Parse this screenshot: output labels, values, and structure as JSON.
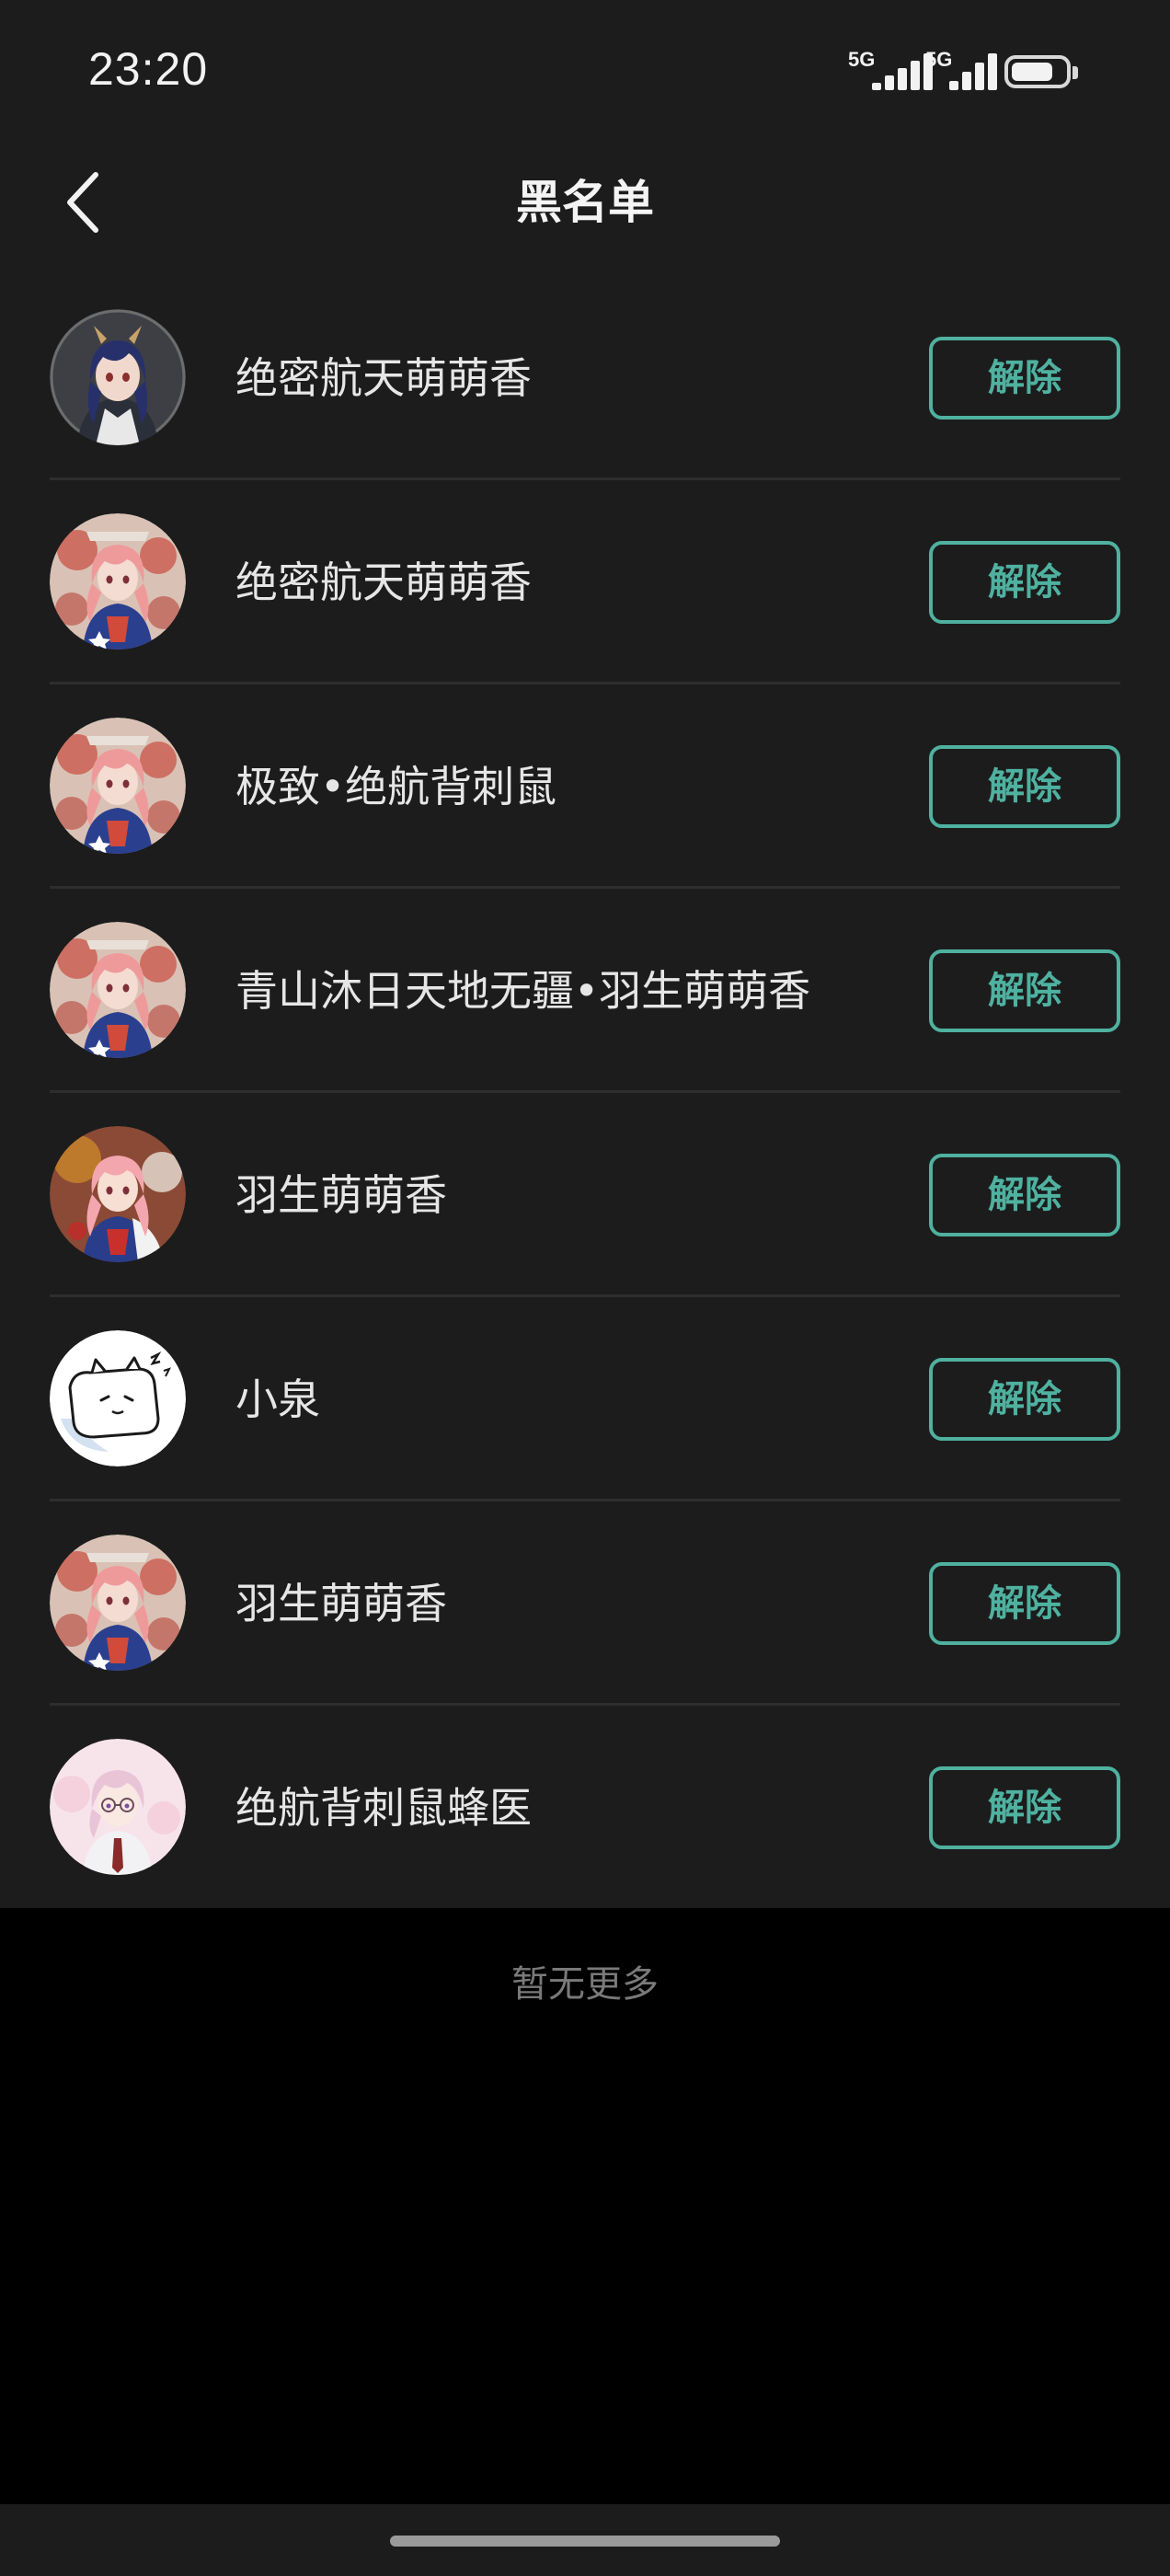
{
  "status_bar": {
    "time": "23:20",
    "network_1": "5G",
    "network_2": "5G"
  },
  "header": {
    "back_icon": "chevron-left-icon",
    "title": "黑名单"
  },
  "blocked_users": [
    {
      "name": "绝密航天萌萌香",
      "action": "解除",
      "avatar": "anime-girl-dark-hair"
    },
    {
      "name": "绝密航天萌萌香",
      "action": "解除",
      "avatar": "anime-girl-pink-hair"
    },
    {
      "name": "极致•绝航背刺鼠",
      "action": "解除",
      "avatar": "anime-girl-pink-hair"
    },
    {
      "name": "青山沐日天地无疆•羽生萌萌香",
      "action": "解除",
      "avatar": "anime-girl-pink-hair"
    },
    {
      "name": "羽生萌萌香",
      "action": "解除",
      "avatar": "anime-girl-pink-hair-bright"
    },
    {
      "name": "小泉",
      "action": "解除",
      "avatar": "cartoon-cat-white"
    },
    {
      "name": "羽生萌萌香",
      "action": "解除",
      "avatar": "anime-girl-pink-hair"
    },
    {
      "name": "绝航背刺鼠蜂医",
      "action": "解除",
      "avatar": "anime-girl-light-pink-glasses"
    }
  ],
  "footer": {
    "no_more": "暂无更多"
  },
  "colors": {
    "accent": "#4fb1a0",
    "panel_bg": "#1c1c1c",
    "page_bg": "#000000",
    "divider": "#2e2e2e"
  }
}
